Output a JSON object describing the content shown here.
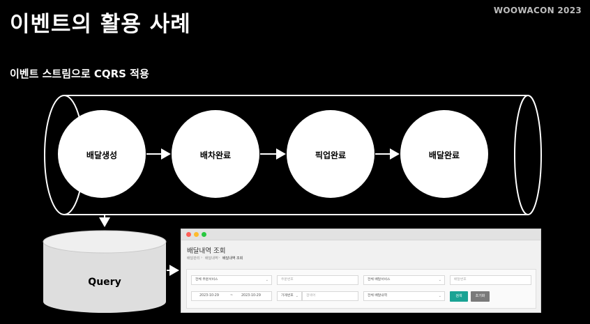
{
  "title": "이벤트의 활용 사례",
  "brand": "WOOWACON 2023",
  "subtitle": "이벤트 스트림으로 CQRS 적용",
  "stream": {
    "events": [
      "배달생성",
      "배차완료",
      "픽업완료",
      "배달완료"
    ]
  },
  "database": {
    "label": "Query"
  },
  "screenshot": {
    "page_title": "배달내역 조회",
    "breadcrumb": [
      "배달관리",
      "배달내역",
      "배달내역 조회"
    ],
    "fields": {
      "order_service": "전체 주문서비스",
      "order_number_placeholder": "주문번호",
      "delivery_service": "전체 배달서비스",
      "delivery_number_placeholder": "배달번호",
      "date_from": "2023-10-29",
      "date_sep": "~",
      "date_to": "2023-10-29",
      "store_select": "가게번호",
      "store_input_placeholder": "검색어",
      "delivery_history": "전체 배달내역"
    },
    "buttons": {
      "search": "검색",
      "reset": "초기화"
    },
    "colors": {
      "search": "#1aa394",
      "reset": "#7a7a7a",
      "close": "#ff5f57",
      "minimize": "#febc2e",
      "zoom": "#28c840"
    }
  }
}
